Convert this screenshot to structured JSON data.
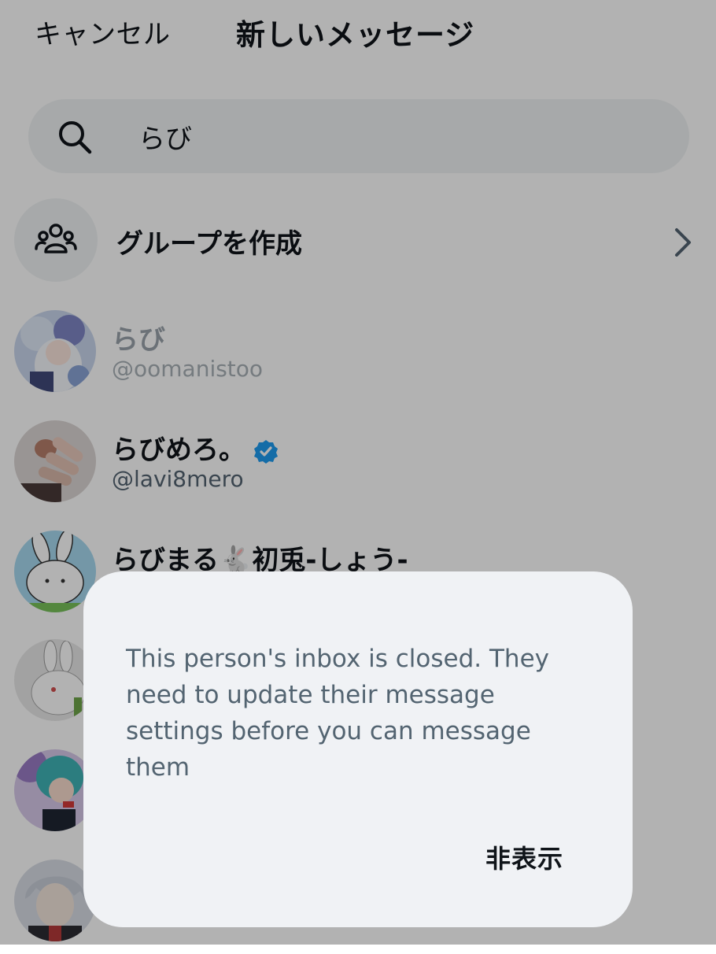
{
  "header": {
    "cancel_label": "キャンセル",
    "title": "新しいメッセージ"
  },
  "search": {
    "value": "らび",
    "icon": "search-icon"
  },
  "group": {
    "label": "グループを作成",
    "icon": "people-group-icon"
  },
  "users": [
    {
      "name": "らび",
      "handle": "@oomanistoo",
      "verified": false,
      "disabled": true
    },
    {
      "name": "らびめろ。",
      "handle": "@lavi8mero",
      "verified": true,
      "disabled": false
    },
    {
      "name": "らびまる🐇初兎-しょう-",
      "handle": "",
      "verified": false,
      "disabled": false
    },
    {
      "name": "",
      "handle": "",
      "verified": false,
      "disabled": false
    },
    {
      "name": "",
      "handle": "",
      "verified": false,
      "disabled": false
    },
    {
      "name": "",
      "handle": "",
      "verified": false,
      "disabled": false
    }
  ],
  "dialog": {
    "message": "This person's inbox is closed. They need to update their message settings before you can message them",
    "hide_label": "非表示"
  },
  "colors": {
    "overlay": "rgba(0,0,0,0.30)",
    "dialog_bg": "#f0f2f5",
    "verified_blue": "#1d9bf0",
    "secondary_text": "#536471"
  }
}
